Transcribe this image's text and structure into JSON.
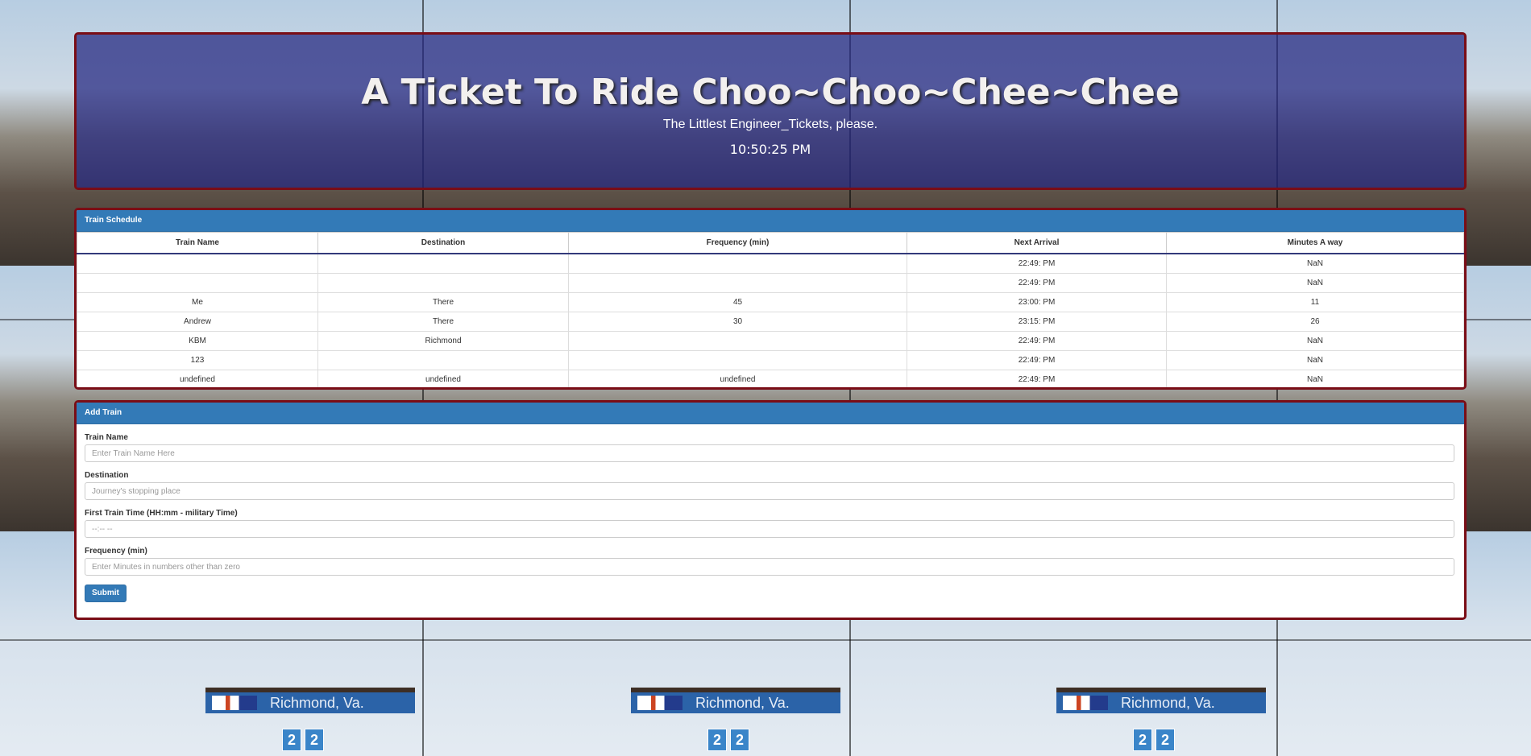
{
  "header": {
    "title": "A Ticket To Ride Choo~Choo~Chee~Chee",
    "subtitle": "The Littlest Engineer_Tickets, please.",
    "clock": "10:50:25 PM"
  },
  "background": {
    "sign_text": "Richmond, Va.",
    "platform_numbers": [
      "2",
      "2"
    ]
  },
  "schedule": {
    "panel_title": "Train Schedule",
    "columns": [
      "Train Name",
      "Destination",
      "Frequency (min)",
      "Next Arrival",
      "Minutes A way"
    ],
    "rows": [
      [
        "",
        "",
        "",
        "22:49: PM",
        "NaN"
      ],
      [
        "",
        "",
        "",
        "22:49: PM",
        "NaN"
      ],
      [
        "Me",
        "There",
        "45",
        "23:00: PM",
        "11"
      ],
      [
        "Andrew",
        "There",
        "30",
        "23:15: PM",
        "26"
      ],
      [
        "KBM",
        "Richmond",
        "",
        "22:49: PM",
        "NaN"
      ],
      [
        "123",
        "",
        "",
        "22:49: PM",
        "NaN"
      ],
      [
        "undefined",
        "undefined",
        "undefined",
        "22:49: PM",
        "NaN"
      ]
    ]
  },
  "add_train": {
    "panel_title": "Add Train",
    "fields": {
      "name_label": "Train Name",
      "name_placeholder": "Enter Train Name Here",
      "destination_label": "Destination",
      "destination_placeholder": "Journey's stopping place",
      "first_time_label": "First Train Time (HH:mm - military Time)",
      "first_time_placeholder": "--:-- --",
      "frequency_label": "Frequency (min)",
      "frequency_placeholder": "Enter Minutes in numbers other than zero"
    },
    "submit_label": "Submit"
  },
  "colors": {
    "panel_heading": "#337ab7",
    "panel_border": "#7a0d16",
    "header_overlay": "#222580"
  }
}
